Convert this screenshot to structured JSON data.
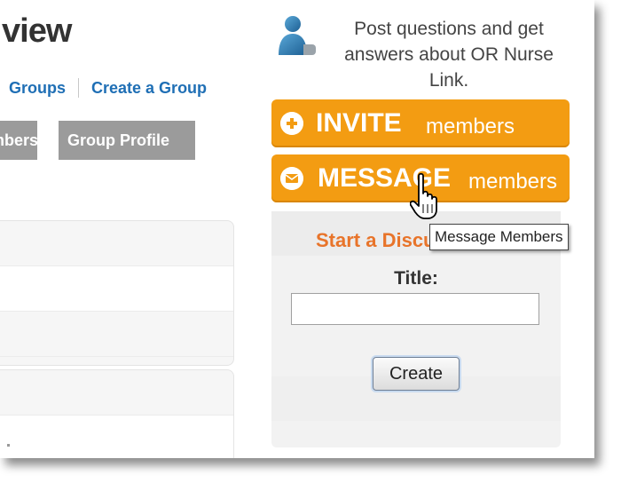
{
  "page": {
    "title": "view"
  },
  "links": {
    "groups": "Groups",
    "create_group": "Create a Group"
  },
  "tabs": [
    {
      "label": "Members"
    },
    {
      "label": "Group Profile"
    }
  ],
  "sidebar": {
    "help_text": "Post questions and get answers about OR Nurse Link.",
    "invite_button": {
      "strong": "INVITE",
      "rest": "members"
    },
    "message_button": {
      "strong": "MESSAGE",
      "rest": "members"
    },
    "discussion": {
      "heading": "Start a Discussion",
      "title_label": "Title:",
      "title_value": "",
      "create_label": "Create"
    }
  },
  "tooltip": {
    "text": "Message Members"
  },
  "colors": {
    "accent": "#f39c12",
    "heading_orange": "#e8742a",
    "link_blue": "#1f6fb5",
    "tab_gray": "#9b9b9b"
  },
  "icons": [
    "user-help-icon",
    "plus-circle-icon",
    "envelope-circle-icon",
    "hand-pointer-cursor-icon"
  ]
}
